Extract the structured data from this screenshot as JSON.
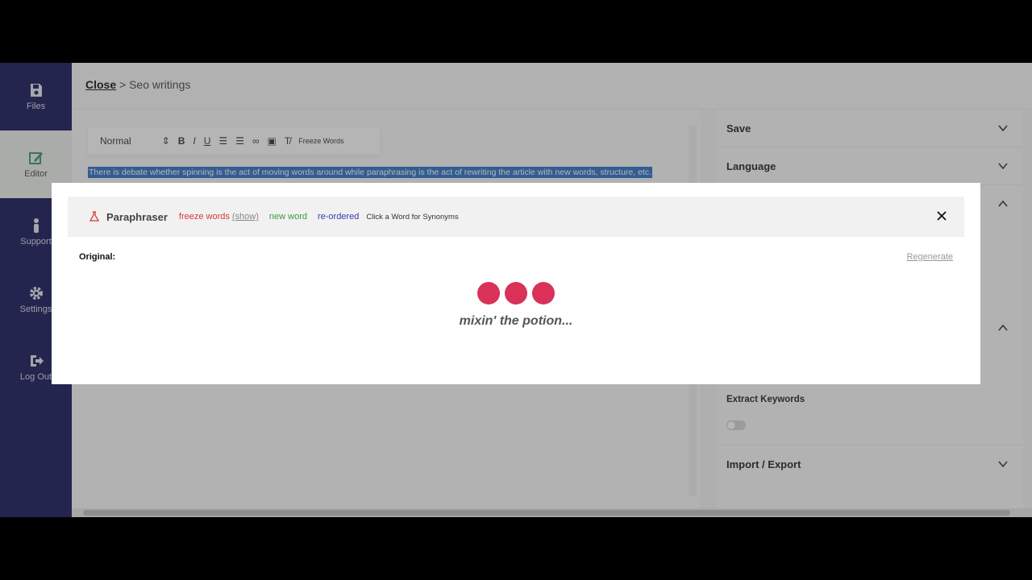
{
  "sidebar": {
    "items": [
      {
        "label": "Files",
        "icon": "save-icon"
      },
      {
        "label": "Editor",
        "icon": "edit-icon"
      },
      {
        "label": "Support",
        "icon": "person-icon"
      },
      {
        "label": "Settings",
        "icon": "gear-icon"
      },
      {
        "label": "Log Out",
        "icon": "logout-icon"
      }
    ]
  },
  "breadcrumb": {
    "close": "Close",
    "separator": ">",
    "current": "Seo writings"
  },
  "toolbar": {
    "format": "Normal",
    "freeze_words": "Freeze Words"
  },
  "editor": {
    "selected_text": "There is debate whether spinning is the act of moving words around while paraphrasing is the act of rewriting the article with new words, structure, etc."
  },
  "right_panel": {
    "save": "Save",
    "language": "Language",
    "extract_keywords": "Extract Keywords",
    "import_export": "Import / Export"
  },
  "modal": {
    "title": "Paraphraser",
    "freeze_words": "freeze words",
    "show": "(show)",
    "new_word": "new word",
    "reordered": "re-ordered",
    "hint": "Click a Word for Synonyms",
    "original_label": "Original:",
    "regenerate": "Regenerate",
    "loading_text": "mixin' the potion..."
  },
  "colors": {
    "sidebar": "#16185a",
    "dots": "#d93158",
    "freeze": "#d9383c",
    "new_word": "#3b9a3b",
    "reordered": "#3a3ab0"
  }
}
